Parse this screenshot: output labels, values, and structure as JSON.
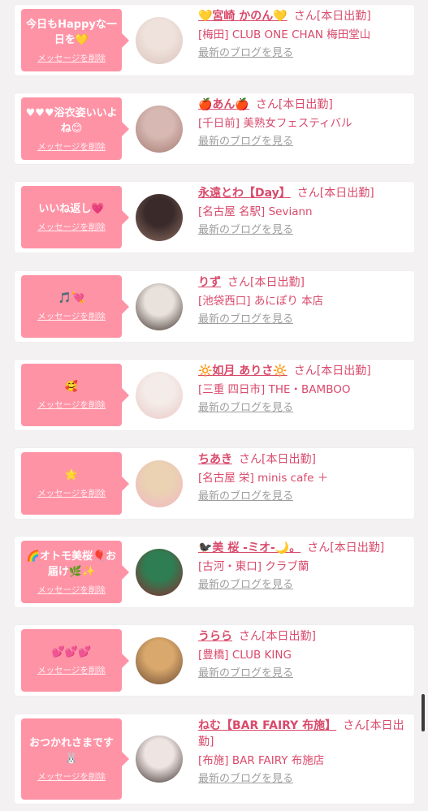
{
  "delete_label": "メッセージを削除",
  "suffix_label": "さん[本日出勤]",
  "blog_label": "最新のブログを見る",
  "cards": [
    {
      "message": "今日もHappyな一日を💛",
      "name": "💛宮崎 かのん💛",
      "shop": "[梅田] CLUB ONE CHAN 梅田堂山",
      "avatar_colors": [
        "#efe2dc",
        "#d9c3bb"
      ]
    },
    {
      "message": "♥♥♥浴衣姿いいよね😊",
      "name": "🍎あん🍎",
      "shop": "[千日前] 美熟女フェスティバル",
      "avatar_colors": [
        "#d7b8b2",
        "#a37a73"
      ]
    },
    {
      "message": "いいね返し💗",
      "name": "永遠とわ【Day】",
      "shop": "[名古屋 名駅] Seviann",
      "avatar_colors": [
        "#3a2b2a",
        "#8f6e62"
      ]
    },
    {
      "message": "🎵💘",
      "name": "りず",
      "shop": "[池袋西口] あにぽり 本店",
      "avatar_colors": [
        "#e9e2dc",
        "#3a2e2a"
      ]
    },
    {
      "message": "🥰",
      "name": "🔆如月 ありさ🔆",
      "shop": "[三重 四日市] THE・BAMBOO",
      "avatar_colors": [
        "#f4ece8",
        "#e9c8c6"
      ]
    },
    {
      "message": "🌟",
      "name": "ちあき",
      "shop": "[名古屋 栄] minis cafe ＋",
      "avatar_colors": [
        "#ead2b2",
        "#f2b6c4"
      ]
    },
    {
      "message": "🌈オトモ美桜🎈お届け🌿✨",
      "name": "🐦‍⬛美 桜 -ミオ-🌙。",
      "shop": "[古河・東口] クラブ蘭",
      "avatar_colors": [
        "#2f7d52",
        "#8c2a2f"
      ]
    },
    {
      "message": "💕💕💕",
      "name": "うらら",
      "shop": "[豊橋] CLUB KING",
      "avatar_colors": [
        "#d9a86c",
        "#6b4a33"
      ]
    },
    {
      "message": "おつかれさまです🐰",
      "name": "ねむ【BAR FAIRY 布施】",
      "shop": "[布施] BAR FAIRY 布施店",
      "avatar_colors": [
        "#eee4e2",
        "#3a2f2c"
      ]
    }
  ]
}
